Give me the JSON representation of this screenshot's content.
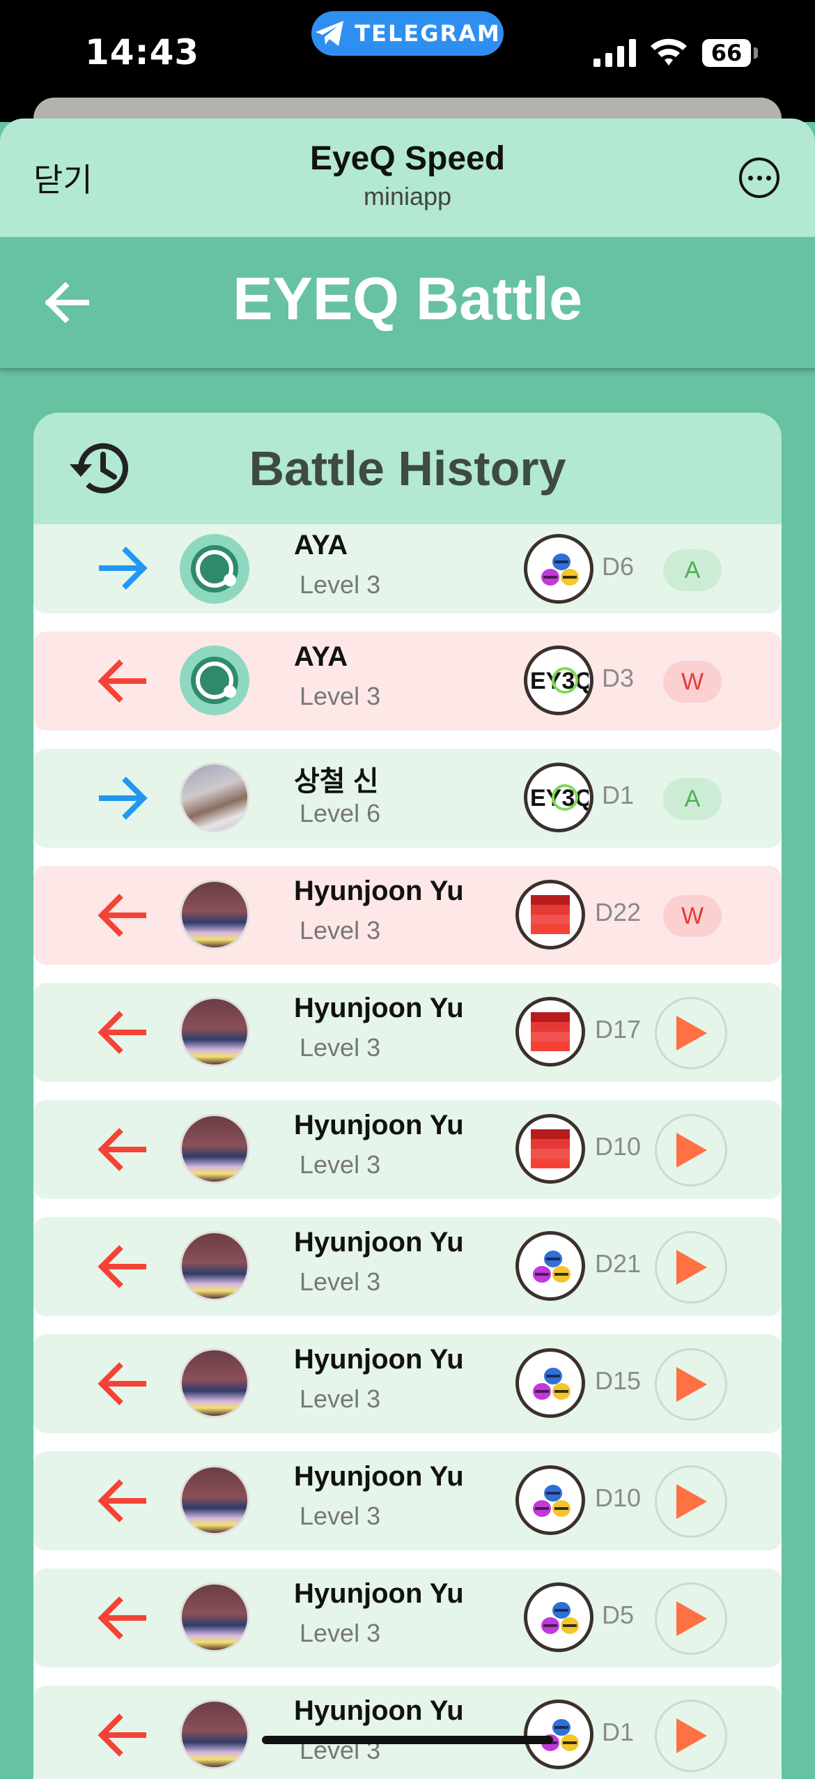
{
  "status_bar": {
    "time": "14:43",
    "pill_label": "TELEGRAM",
    "battery": "66"
  },
  "telegram_header": {
    "close_label": "닫기",
    "title": "EyeQ Speed",
    "subtitle": "miniapp"
  },
  "app": {
    "title": "EYEQ Battle"
  },
  "history": {
    "title": "Battle History",
    "rows": [
      {
        "direction": "outgoing",
        "name": "AYA",
        "level": "Level 3",
        "badge": "bees",
        "code": "D6",
        "status": "A",
        "bg": "green",
        "avatar": "aya"
      },
      {
        "direction": "incoming",
        "name": "AYA",
        "level": "Level 3",
        "badge": "eyeq",
        "code": "D3",
        "status": "W",
        "bg": "pink",
        "avatar": "aya"
      },
      {
        "direction": "outgoing",
        "name": "상철 신",
        "level": "Level 6",
        "badge": "eyeq",
        "code": "D1",
        "status": "A",
        "bg": "green",
        "avatar": "cat"
      },
      {
        "direction": "incoming",
        "name": "Hyunjoon Yu",
        "level": "Level 3",
        "badge": "stripes",
        "code": "D22",
        "status": "W",
        "bg": "pink",
        "avatar": "crowd"
      },
      {
        "direction": "incoming",
        "name": "Hyunjoon Yu",
        "level": "Level 3",
        "badge": "stripes",
        "code": "D17",
        "status": "play",
        "bg": "green",
        "avatar": "crowd"
      },
      {
        "direction": "incoming",
        "name": "Hyunjoon Yu",
        "level": "Level 3",
        "badge": "stripes",
        "code": "D10",
        "status": "play",
        "bg": "green",
        "avatar": "crowd"
      },
      {
        "direction": "incoming",
        "name": "Hyunjoon Yu",
        "level": "Level 3",
        "badge": "bees",
        "code": "D21",
        "status": "play",
        "bg": "green",
        "avatar": "crowd"
      },
      {
        "direction": "incoming",
        "name": "Hyunjoon Yu",
        "level": "Level 3",
        "badge": "bees",
        "code": "D15",
        "status": "play",
        "bg": "green",
        "avatar": "crowd"
      },
      {
        "direction": "incoming",
        "name": "Hyunjoon Yu",
        "level": "Level 3",
        "badge": "bees",
        "code": "D10",
        "status": "play",
        "bg": "green",
        "avatar": "crowd"
      },
      {
        "direction": "incoming",
        "name": "Hyunjoon Yu",
        "level": "Level 3",
        "badge": "bees",
        "code": "D5",
        "status": "play",
        "bg": "green",
        "avatar": "crowd"
      },
      {
        "direction": "incoming",
        "name": "Hyunjoon Yu",
        "level": "Level 3",
        "badge": "bees",
        "code": "D1",
        "status": "play",
        "bg": "green",
        "avatar": "crowd"
      }
    ]
  },
  "colors": {
    "outgoing_arrow": "#2196f3",
    "incoming_arrow": "#f44336",
    "accent": "#66c2a0",
    "play": "#ff7043"
  }
}
